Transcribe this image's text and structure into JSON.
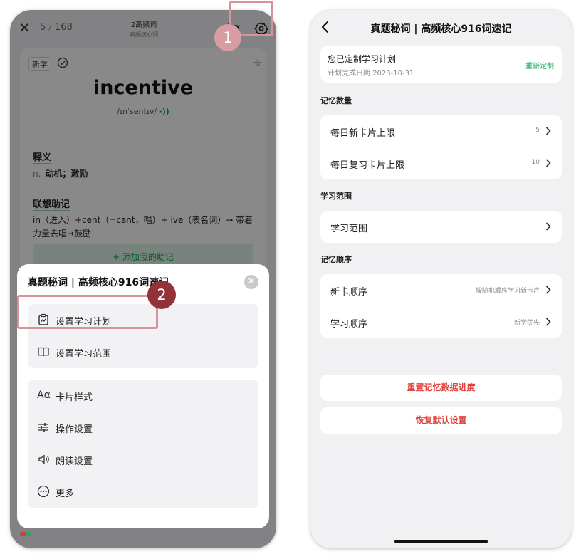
{
  "left": {
    "topbar": {
      "close": "✕",
      "counter_current": "5",
      "counter_sep": " / ",
      "counter_total": "168",
      "title": "2高频词",
      "subtitle": "高频核心词",
      "font_button": "Aα"
    },
    "card": {
      "tag": "新学",
      "word": "incentive",
      "phonetic": "/ɪnˈsentɪv/",
      "speaker": "·))",
      "meaning_heading": "释义",
      "pos": "n.",
      "meaning": "动机；激励",
      "memo_heading": "联想助记",
      "memo_text": "in（进入）+cent（=cant，唱）+ ive（表名词）→ 带着力量去唱→鼓励",
      "add_memo": "+ 添加我的助记"
    },
    "sheet": {
      "title": "真题秘词 | 高频核心916词速记",
      "close": "✕",
      "group1": [
        {
          "label": "设置学习计划",
          "icon": "📈"
        },
        {
          "label": "设置学习范围",
          "icon": "📖"
        }
      ],
      "group2": [
        {
          "label": "卡片样式",
          "icon": "Aα"
        },
        {
          "label": "操作设置",
          "icon": "☰"
        },
        {
          "label": "朗读设置",
          "icon": "🔊"
        },
        {
          "label": "更多",
          "icon": "⋯"
        }
      ]
    },
    "annotations": {
      "step1": "1",
      "step2": "2"
    }
  },
  "right": {
    "title": "真题秘词 | 高频核心916词速记",
    "plan": {
      "title": "您已定制学习计划",
      "date": "计划完成日期 2023-10-31",
      "action": "重新定制"
    },
    "sections": {
      "memory_count": "记忆数量",
      "study_range": "学习范围",
      "memory_order": "记忆顺序"
    },
    "memory_count_rows": [
      {
        "label": "每日新卡片上限",
        "value": "5"
      },
      {
        "label": "每日复习卡片上限",
        "value": "10"
      }
    ],
    "range_row": {
      "label": "学习范围"
    },
    "order_rows": [
      {
        "label": "新卡顺序",
        "value": "按随机顺序学习新卡片"
      },
      {
        "label": "学习顺序",
        "value": "新学优先"
      }
    ],
    "reset_button": "重置记忆数据进度",
    "restore_button": "恢复默认设置"
  },
  "colors": {
    "accent_green": "#17a35c",
    "danger_red": "#e0433e",
    "annotation_ring": "#d7929a",
    "badge1": "#d89da2",
    "badge2": "#953238"
  }
}
